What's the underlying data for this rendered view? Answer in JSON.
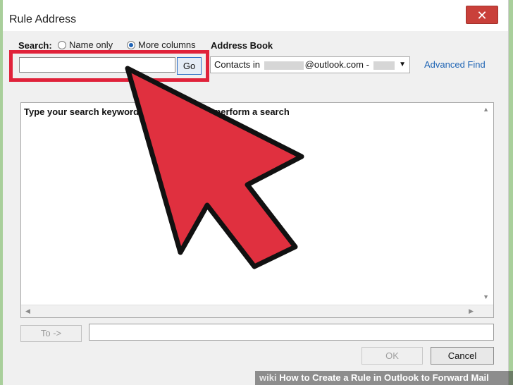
{
  "window": {
    "title": "Rule Address",
    "close_symbol": "✕"
  },
  "search": {
    "label": "Search:",
    "option_name_only": "Name only",
    "option_more_columns": "More columns",
    "selected": "More columns",
    "input_value": "",
    "go_label": "Go"
  },
  "address_book": {
    "label": "Address Book",
    "prefix": "Contacts in",
    "suffix": "@outlook.com -",
    "dropdown_arrow": "▼",
    "advanced_find": "Advanced Find"
  },
  "results": {
    "text_left": "Type your search keywords",
    "text_right": "perform a search"
  },
  "footer_buttons": {
    "to_label": "To ->",
    "ok_label": "OK",
    "cancel_label": "Cancel"
  },
  "banner": {
    "wiki": "wiki",
    "title": "How to Create a Rule in Outlook to Forward Mail"
  },
  "colors": {
    "highlight": "#e0223a",
    "arrow_fill": "#e0303f",
    "link": "#1e64b4",
    "close": "#c9403a",
    "frame": "#a9cf9b"
  }
}
